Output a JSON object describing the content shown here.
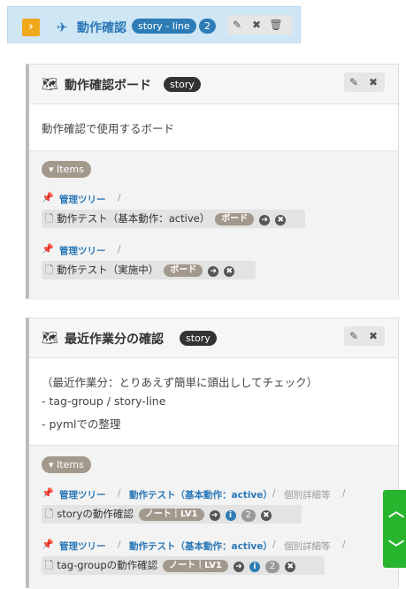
{
  "topbar": {
    "expand_glyph": "›",
    "title": "動作確認",
    "tag": "story - line",
    "count": "2"
  },
  "cards": [
    {
      "title": "動作確認ボード",
      "badge": "story",
      "body_lines": [
        "動作確認で使用するボード"
      ],
      "items_label": "Items",
      "entries": [
        {
          "crumbs": [
            "管理ツリー",
            "/"
          ],
          "node": "動作テスト（基本動作：active）",
          "tag": "ボード"
        },
        {
          "crumbs": [
            "管理ツリー",
            "/"
          ],
          "node": "動作テスト（実施中）",
          "tag": "ボード"
        }
      ]
    },
    {
      "title": "最近作業分の確認",
      "badge": "story",
      "body_lines": [
        "（最近作業分：とりあえず簡単に頭出ししてチェック）",
        "- tag-group / story-line",
        "- pymlでの整理"
      ],
      "items_label": "Items",
      "entries": [
        {
          "crumbs": [
            "管理ツリー",
            "/",
            "動作テスト（基本動作：active）",
            "/",
            "個別詳細等",
            "/"
          ],
          "node": "storyの動作確認",
          "tag": "ノート｜LV1",
          "count": "2"
        },
        {
          "crumbs": [
            "管理ツリー",
            "/",
            "動作テスト（基本動作：active）",
            "/",
            "個別詳細等",
            "/"
          ],
          "node": "tag-groupの動作確認",
          "tag": "ノート｜LV1",
          "count": "2"
        }
      ]
    }
  ],
  "side": {
    "up": "︿",
    "down": "﹀"
  },
  "colors": {
    "accent": "#2a78b8",
    "topbar_bg": "#cfe6f5",
    "expand": "#f0a81b",
    "tag": "#a3988c",
    "green": "#27b52e"
  }
}
